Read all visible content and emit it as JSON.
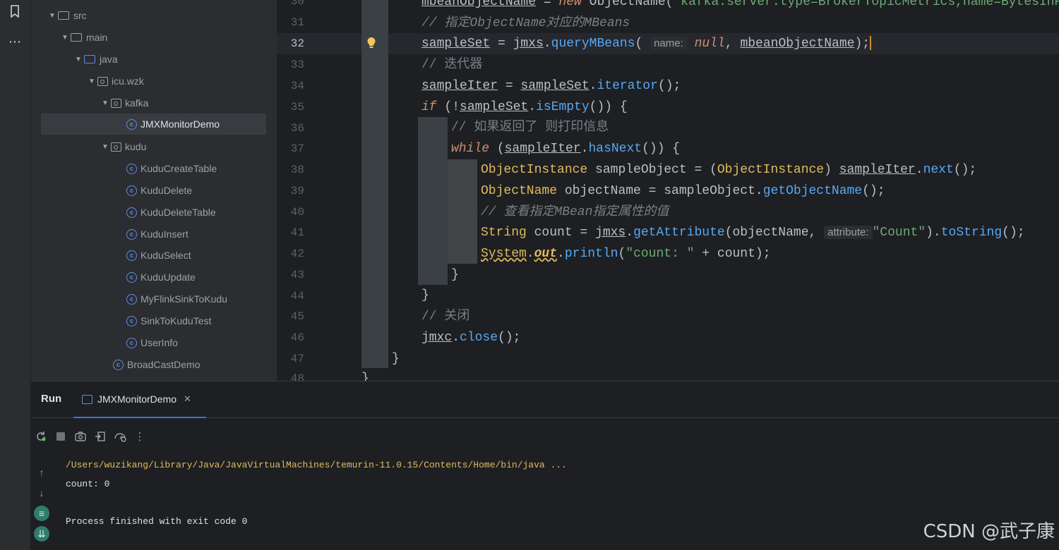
{
  "tree": {
    "items": [
      {
        "label": "src",
        "kind": "folder",
        "expanded": true
      },
      {
        "label": "main",
        "kind": "folder",
        "expanded": true
      },
      {
        "label": "java",
        "kind": "java-folder",
        "expanded": true
      },
      {
        "label": "icu.wzk",
        "kind": "package",
        "expanded": true
      },
      {
        "label": "kafka",
        "kind": "package",
        "expanded": true
      },
      {
        "label": "JMXMonitorDemo",
        "kind": "class",
        "selected": true
      },
      {
        "label": "kudu",
        "kind": "package",
        "expanded": true
      },
      {
        "label": "KuduCreateTable",
        "kind": "class"
      },
      {
        "label": "KuduDelete",
        "kind": "class"
      },
      {
        "label": "KuduDeleteTable",
        "kind": "class"
      },
      {
        "label": "KuduInsert",
        "kind": "class"
      },
      {
        "label": "KuduSelect",
        "kind": "class"
      },
      {
        "label": "KuduUpdate",
        "kind": "class"
      },
      {
        "label": "MyFlinkSinkToKudu",
        "kind": "class"
      },
      {
        "label": "SinkToKuduTest",
        "kind": "class"
      },
      {
        "label": "UserInfo",
        "kind": "class"
      },
      {
        "label": "BroadCastDemo",
        "kind": "class"
      }
    ]
  },
  "editor": {
    "line_numbers": [
      "30",
      "31",
      "32",
      "33",
      "34",
      "35",
      "36",
      "37",
      "38",
      "39",
      "40",
      "41",
      "42",
      "43",
      "44",
      "45",
      "46",
      "47",
      "48"
    ],
    "current_line": "32",
    "line30": {
      "var": "mbeanObjectName",
      "eq": " = ",
      "new": "new",
      "type": " ObjectName(",
      "str": "\"kafka.server:type=BrokerTopicMetrics,name=BytesInPer"
    },
    "line31": "// 指定ObjectName对应的MBeans",
    "line32": {
      "var": "sampleSet",
      "eq": " = ",
      "obj": "jmxs",
      "call": "queryMBeans",
      "hint": "name:",
      "null": "null",
      "arg": "mbeanObjectName",
      "end": ");"
    },
    "line33": "// 迭代器",
    "line34": {
      "var": "sampleIter",
      "eq": " = ",
      "obj": "sampleSet",
      "call": "iterator",
      "end": "();"
    },
    "line35": {
      "kw": "if",
      "open": " (!",
      "obj": "sampleSet",
      "call": "isEmpty",
      "end": "()) {"
    },
    "line36": "// 如果返回了 则打印信息",
    "line37": {
      "kw": "while",
      "open": " (",
      "obj": "sampleIter",
      "call": "hasNext",
      "end": "()) {"
    },
    "line38": {
      "type": "ObjectInstance",
      "var": " sampleObject = (",
      "cast": "ObjectInstance",
      "mid": ") ",
      "obj": "sampleIter",
      "call": "next",
      "end": "();"
    },
    "line39": {
      "type": "ObjectName",
      "var": " objectName = sampleObject.",
      "call": "getObjectName",
      "end": "();"
    },
    "line40": "// 查看指定MBean指定属性的值",
    "line41": {
      "type": "String",
      "var": " count = ",
      "obj": "jmxs",
      "call": "getAttribute",
      "arg": "(objectName, ",
      "hint": "attribute:",
      "str": "\"Count\"",
      "call2": "toString",
      "end": "();"
    },
    "line42": {
      "cls": "System",
      "fld": "out",
      "call": "println",
      "str": "\"count: \"",
      "end": " + count);"
    },
    "line43": "}",
    "line44": "}",
    "line45": "// 关闭",
    "line46": {
      "obj": "jmxc",
      "call": "close",
      "end": "();"
    },
    "line47": "}",
    "line48": "}"
  },
  "run": {
    "title": "Run",
    "tab_label": "JMXMonitorDemo",
    "console": {
      "path_line": "/Users/wuzikang/Library/Java/JavaVirtualMachines/temurin-11.0.15/Contents/Home/bin/java ...",
      "output_line": "count: 0",
      "exit_line": "Process finished with exit code 0"
    }
  },
  "watermark": "CSDN @武子康"
}
